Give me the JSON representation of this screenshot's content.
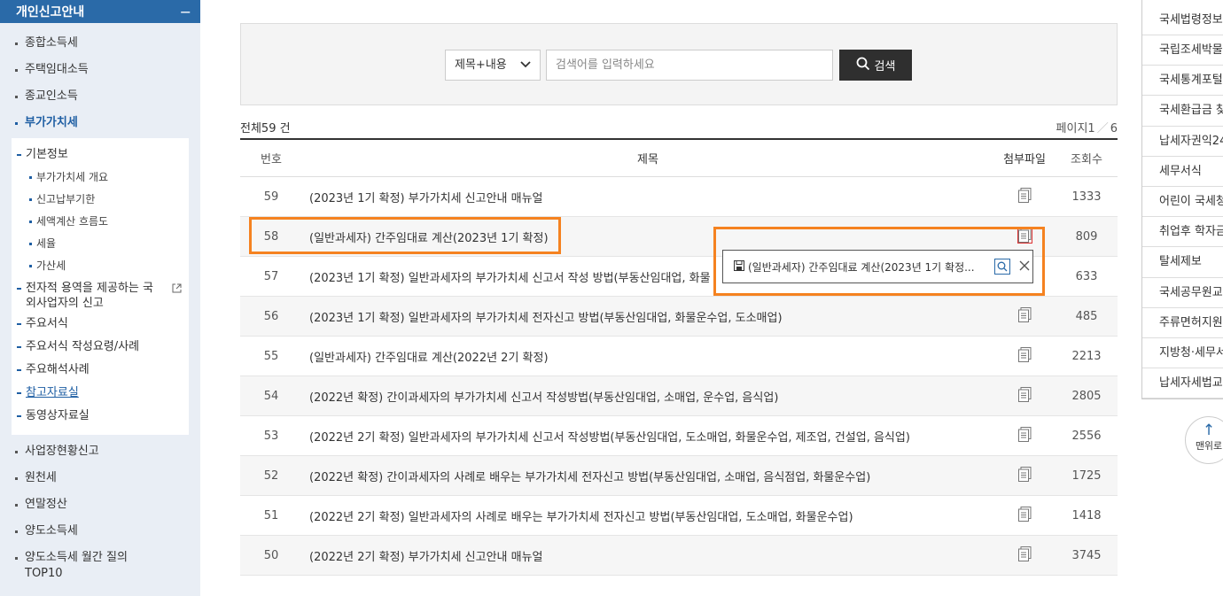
{
  "sidebar": {
    "header": "개인신고안내",
    "header_toggle": "−",
    "items_top": [
      "종합소득세",
      "주택임대소득",
      "종교인소득"
    ],
    "active_item": "부가가치세",
    "sub": {
      "basic": "기본정보",
      "basic_children": [
        "부가가치세 개요",
        "신고납부기한",
        "세액계산 흐름도",
        "세율",
        "가산세"
      ],
      "foreign": "전자적 용역을 제공하는 국외사업자의 신고",
      "forms": "주요서식",
      "forms_guide": "주요서식 작성요령/사례",
      "interpret": "주요해석사례",
      "reference": "참고자료실",
      "video": "동영상자료실"
    },
    "items_bottom": [
      "사업장현황신고",
      "원천세",
      "연말정산",
      "양도소득세",
      "양도소득세 월간 질의 TOP10"
    ]
  },
  "search": {
    "select_value": "제목+내용",
    "placeholder": "검색어를 입력하세요",
    "button_label": "검색"
  },
  "board": {
    "total_label": "전체59 건",
    "page_label": "페이지1",
    "page_total": "6",
    "headers": {
      "no": "번호",
      "title": "제목",
      "file": "첨부파일",
      "views": "조회수"
    },
    "rows": [
      {
        "no": "59",
        "title": "(2023년 1기 확정) 부가가치세 신고안내 매뉴얼",
        "views": "1333"
      },
      {
        "no": "58",
        "title": "(일반과세자) 간주임대료 계산(2023년 1기 확정)",
        "views": "809"
      },
      {
        "no": "57",
        "title": "(2023년 1기 확정) 일반과세자의 부가가치세 신고서 작성 방법(부동산임대업, 화물",
        "views": "633"
      },
      {
        "no": "56",
        "title": "(2023년 1기 확정) 일반과세자의 부가가치세 전자신고 방법(부동산임대업, 화물운수업, 도소매업)",
        "views": "485"
      },
      {
        "no": "55",
        "title": "(일반과세자) 간주임대료 계산(2022년 2기 확정)",
        "views": "2213"
      },
      {
        "no": "54",
        "title": "(2022년 확정) 간이과세자의 부가가치세 신고서 작성방법(부동산임대업, 소매업, 운수업, 음식업)",
        "views": "2805"
      },
      {
        "no": "53",
        "title": "(2022년 2기 확정) 일반과세자의 부가가치세 신고서 작성방법(부동산임대업, 도소매업, 화물운수업, 제조업, 건설업, 음식업)",
        "views": "2556"
      },
      {
        "no": "52",
        "title": "(2022년 확정) 간이과세자의 사례로 배우는 부가가치세 전자신고 방법(부동산임대업, 소매업, 음식점업, 화물운수업)",
        "views": "1725"
      },
      {
        "no": "51",
        "title": "(2022년 2기 확정) 일반과세자의 사례로 배우는 부가가치세 전자신고 방법(부동산임대업, 도소매업, 화물운수업)",
        "views": "1418"
      },
      {
        "no": "50",
        "title": "(2022년 2기 확정) 부가가치세 신고안내 매뉴얼",
        "views": "3745"
      }
    ]
  },
  "popup": {
    "file_name": "(일반과세자) 간주임대료 계산(2023년 1기 확정..."
  },
  "right_links": [
    "국세법령정보",
    "국립조세박물",
    "국세통계포털",
    "국세환급금 찾",
    "납세자권익24",
    "세무서식",
    "어린이 국세청",
    "취업후 학자금",
    "탈세제보",
    "국세공무원교",
    "주류면허지원",
    "지방청·세무서",
    "납세자세법교"
  ],
  "top_button": {
    "arrow": "↑",
    "label": "맨위로"
  },
  "colors": {
    "accent": "#2a6aa8",
    "highlight": "#f58220",
    "dark_button": "#2f2f2f"
  }
}
